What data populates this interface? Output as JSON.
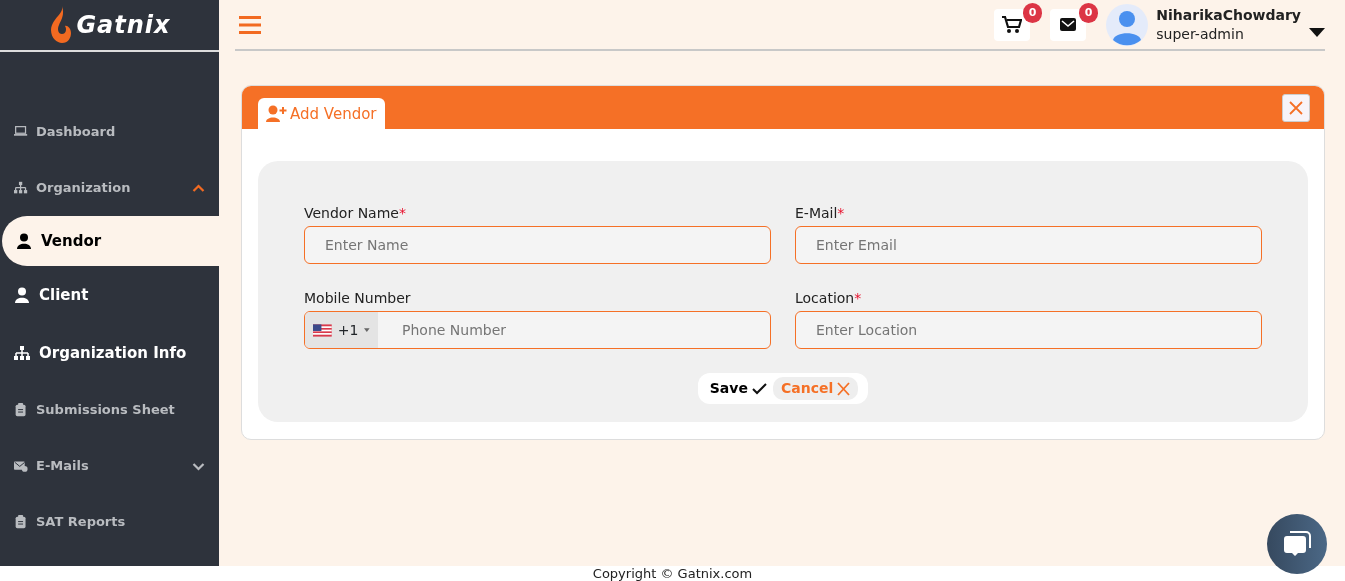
{
  "brand": {
    "name": "Gatnix"
  },
  "sidebar": {
    "items": [
      {
        "label": "Dashboard",
        "selected": false
      },
      {
        "label": "Organization",
        "expanded": true,
        "selected": false,
        "children": [
          {
            "label": "Vendor",
            "selected": true
          },
          {
            "label": "Client",
            "selected": false
          },
          {
            "label": "Organization Info",
            "selected": false
          }
        ]
      },
      {
        "label": "Submissions Sheet",
        "selected": false
      },
      {
        "label": "E-Mails",
        "expanded": false,
        "selected": false
      },
      {
        "label": "SAT Reports",
        "selected": false
      }
    ]
  },
  "header": {
    "cart_count": "0",
    "mail_count": "0",
    "user": {
      "name": "NiharikaChowdary",
      "role": "super-admin"
    }
  },
  "card": {
    "tab": "Add Vendor",
    "fields": [
      {
        "kind": "text",
        "label": "Vendor Name",
        "required_mark": "*",
        "placeholder": "Enter Name"
      },
      {
        "kind": "text",
        "label": "E-Mail",
        "required_mark": "*",
        "placeholder": "Enter Email"
      },
      {
        "kind": "phone",
        "label": "Mobile Number",
        "country_code": "+1",
        "placeholder": "Phone Number"
      },
      {
        "kind": "text",
        "label": "Location",
        "required_mark": "*",
        "placeholder": "Enter Location"
      }
    ],
    "buttons": [
      {
        "kind": "save",
        "label": "Save"
      },
      {
        "kind": "cancel",
        "label": "Cancel"
      }
    ]
  },
  "footer": {
    "text": "Copyright © Gatnix.com"
  }
}
